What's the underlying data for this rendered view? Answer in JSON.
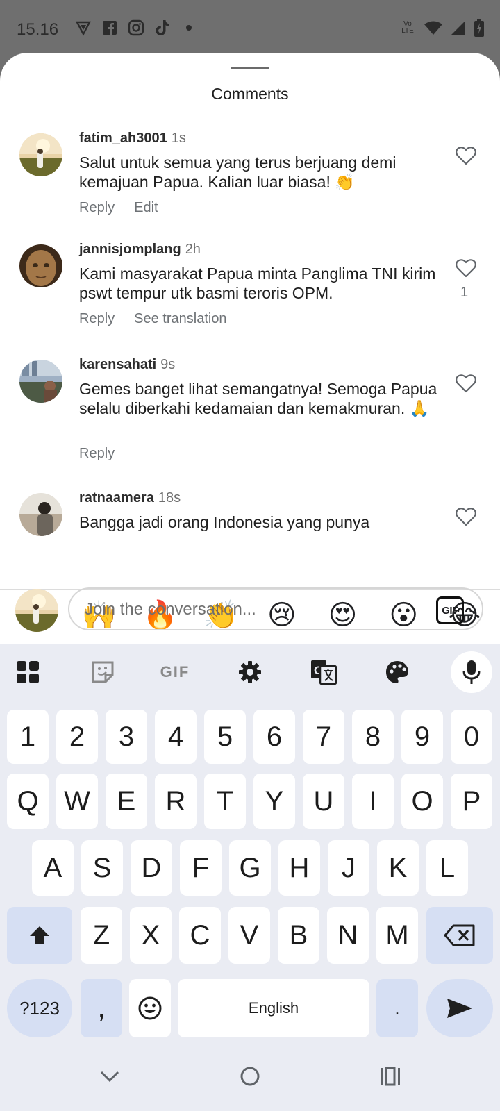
{
  "status_bar": {
    "time": "15.16",
    "left_icons": [
      "vpn-shield-icon",
      "facebook-icon",
      "instagram-icon",
      "tiktok-icon",
      "dot-icon"
    ],
    "right_icons": [
      "volte-icon",
      "wifi-icon",
      "signal-icon",
      "battery-icon"
    ],
    "volte_text": "Vo LTE"
  },
  "sheet": {
    "title": "Comments"
  },
  "comments": [
    {
      "username": "fatim_ah3001",
      "time": "1s",
      "text": "Salut untuk semua yang terus berjuang demi kemajuan Papua. Kalian luar biasa! 👏",
      "actions": [
        "Reply",
        "Edit"
      ],
      "likes": ""
    },
    {
      "username": "jannisjomplang",
      "time": "2h",
      "text": "Kami masyarakat Papua minta Panglima TNI kirim pswt tempur utk basmi teroris OPM.",
      "actions": [
        "Reply",
        "See translation"
      ],
      "likes": "1"
    },
    {
      "username": "karensahati",
      "time": "9s",
      "text": "Gemes banget lihat semangatnya! Semoga Papua selalu diberkahi kedamaian dan kemakmuran. 🙏",
      "actions": [
        "Reply"
      ],
      "likes": ""
    },
    {
      "username": "ratnaamera",
      "time": "18s",
      "text": "Bangga jadi orang Indonesia yang punya",
      "actions": [],
      "likes": ""
    }
  ],
  "emoji_bar": [
    "❤️",
    "🙌",
    "🔥",
    "👏",
    "😢",
    "😍",
    "😮",
    "😂"
  ],
  "composer": {
    "placeholder": "Join the conversation...",
    "gif_label": "GIF"
  },
  "keyboard": {
    "toolbar": [
      "apps-grid-icon",
      "sticker-icon",
      "gif-icon",
      "settings-gear-icon",
      "translate-icon",
      "palette-icon",
      "mic-icon"
    ],
    "toolbar_gif_label": "GIF",
    "row_numbers": [
      "1",
      "2",
      "3",
      "4",
      "5",
      "6",
      "7",
      "8",
      "9",
      "0"
    ],
    "row_q": [
      "Q",
      "W",
      "E",
      "R",
      "T",
      "Y",
      "U",
      "I",
      "O",
      "P"
    ],
    "row_a": [
      "A",
      "S",
      "D",
      "F",
      "G",
      "H",
      "J",
      "K",
      "L"
    ],
    "row_z": [
      "Z",
      "X",
      "C",
      "V",
      "B",
      "N",
      "M"
    ],
    "symbols_label": "?123",
    "comma_label": ",",
    "space_label": "English",
    "period_label": "."
  },
  "nav_bar": [
    "back-chevron-icon",
    "home-circle-icon",
    "recents-icon"
  ],
  "colors": {
    "accent_key": "#d6dff3",
    "keyboard_bg": "#eaecf3",
    "scrim": "#6f6f6f"
  }
}
